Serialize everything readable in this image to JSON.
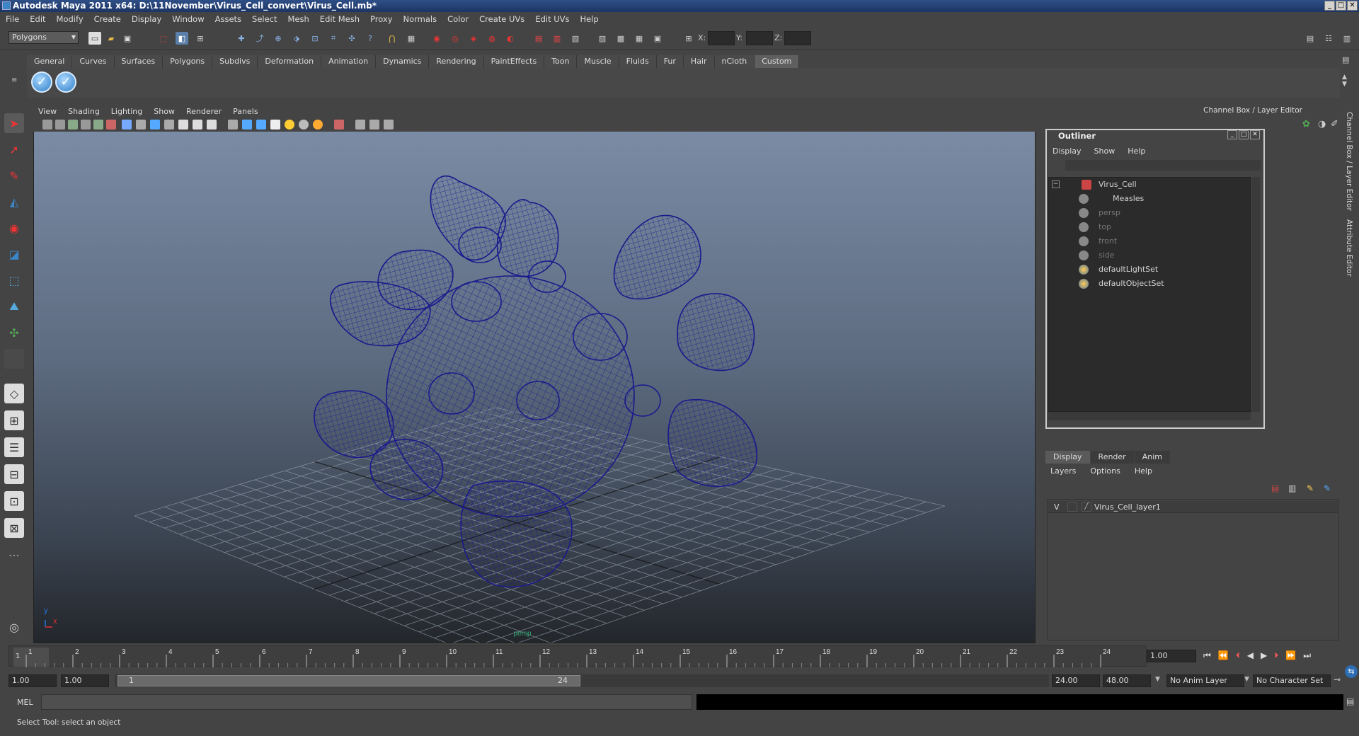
{
  "window": {
    "title": "Autodesk Maya 2011 x64: D:\\11November\\Virus_Cell_convert\\Virus_Cell.mb*",
    "min": "_",
    "max": "□",
    "close": "✕"
  },
  "menubar": [
    "File",
    "Edit",
    "Modify",
    "Create",
    "Display",
    "Window",
    "Assets",
    "Select",
    "Mesh",
    "Edit Mesh",
    "Proxy",
    "Normals",
    "Color",
    "Create UVs",
    "Edit UVs",
    "Help"
  ],
  "statusline": {
    "mode": "Polygons",
    "x_label": "X:",
    "y_label": "Y:",
    "z_label": "Z:"
  },
  "shelf_tabs": [
    "General",
    "Curves",
    "Surfaces",
    "Polygons",
    "Subdivs",
    "Deformation",
    "Animation",
    "Dynamics",
    "Rendering",
    "PaintEffects",
    "Toon",
    "Muscle",
    "Fluids",
    "Fur",
    "Hair",
    "nCloth",
    "Custom"
  ],
  "shelf_active": "Custom",
  "viewport": {
    "menu": [
      "View",
      "Shading",
      "Lighting",
      "Show",
      "Renderer",
      "Panels"
    ],
    "camera_label": "persp",
    "axis_y": "y",
    "axis_x": "x"
  },
  "channel_box_title": "Channel Box / Layer Editor",
  "side_tabs": [
    "Channel Box / Layer Editor",
    "Attribute Editor"
  ],
  "outliner": {
    "title": "Outliner",
    "menu": [
      "Display",
      "Show",
      "Help"
    ],
    "items": [
      {
        "label": "Virus_Cell",
        "dim": false
      },
      {
        "label": "Measles",
        "dim": false
      },
      {
        "label": "persp",
        "dim": true
      },
      {
        "label": "top",
        "dim": true
      },
      {
        "label": "front",
        "dim": true
      },
      {
        "label": "side",
        "dim": true
      },
      {
        "label": "defaultLightSet",
        "dim": false
      },
      {
        "label": "defaultObjectSet",
        "dim": false
      }
    ]
  },
  "layer_editor": {
    "tabs": [
      "Display",
      "Render",
      "Anim"
    ],
    "active_tab": "Display",
    "menu": [
      "Layers",
      "Options",
      "Help"
    ],
    "layer": {
      "visible": "V",
      "name": "Virus_Cell_layer1"
    }
  },
  "timeline": {
    "ticks": [
      "1",
      "2",
      "3",
      "4",
      "5",
      "6",
      "7",
      "8",
      "9",
      "10",
      "11",
      "12",
      "13",
      "14",
      "15",
      "16",
      "17",
      "18",
      "19",
      "20",
      "21",
      "22",
      "23",
      "24"
    ],
    "current_frame_marker": "1",
    "current_time": "1.00"
  },
  "range": {
    "start": "1.00",
    "anim_start": "1.00",
    "slider_start": "1",
    "slider_end": "24",
    "anim_end": "24.00",
    "end": "48.00",
    "anim_layer": "No Anim Layer",
    "char_set": "No Character Set"
  },
  "cmdline": {
    "label": "MEL"
  },
  "helpline": "Select Tool: select an object",
  "colors": {
    "wire": "#1a1a8c",
    "accent": "#3a86c7"
  }
}
